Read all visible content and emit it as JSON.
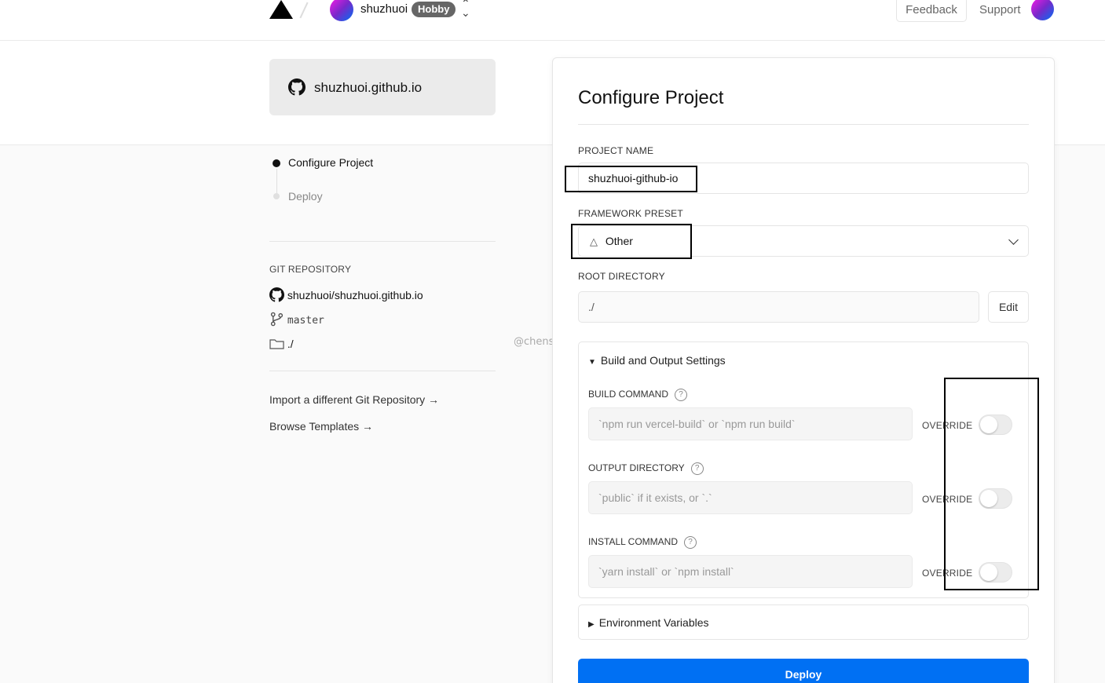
{
  "header": {
    "team_name": "shuzhuoi",
    "plan_badge": "Hobby",
    "switcher_icon": "chevron-up-down-icon",
    "feedback_label": "Feedback",
    "support_label": "Support"
  },
  "repo_card": {
    "icon": "github-icon",
    "name": "shuzhuoi.github.io"
  },
  "steps": [
    {
      "label": "Configure Project",
      "active": true
    },
    {
      "label": "Deploy",
      "active": false
    }
  ],
  "git": {
    "section_label": "GIT REPOSITORY",
    "repo": "shuzhuoi/shuzhuoi.github.io",
    "branch": "master",
    "directory": "./"
  },
  "links": {
    "import_repo": "Import a different Git Repository →",
    "browse_templates": "Browse Templates →"
  },
  "watermark": "@chenshuzhuo",
  "configure": {
    "title": "Configure Project",
    "project_name_label": "PROJECT NAME",
    "project_name_value": "shuzhuoi-github-io",
    "framework_label": "FRAMEWORK PRESET",
    "framework_value": "Other",
    "root_dir_label": "ROOT DIRECTORY",
    "root_dir_value": "./",
    "edit_label": "Edit",
    "build_settings": {
      "heading": "Build and Output Settings",
      "expanded": true,
      "override_label": "OVERRIDE",
      "fields": [
        {
          "label": "BUILD COMMAND",
          "placeholder": "`npm run vercel-build` or `npm run build`",
          "override": false
        },
        {
          "label": "OUTPUT DIRECTORY",
          "placeholder": "`public` if it exists, or `.`",
          "override": false
        },
        {
          "label": "INSTALL COMMAND",
          "placeholder": "`yarn install` or `npm install`",
          "override": false
        }
      ]
    },
    "env_vars": {
      "heading": "Environment Variables",
      "expanded": false
    },
    "deploy_label": "Deploy"
  },
  "colors": {
    "accent": "#0070f3",
    "badge_bg": "#666666"
  }
}
